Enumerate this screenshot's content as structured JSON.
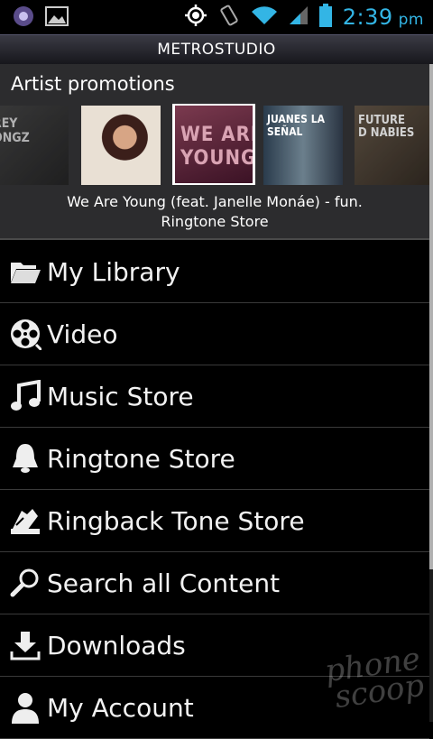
{
  "status_bar": {
    "time": "2:39",
    "ampm": "pm",
    "icons": [
      "app-icon",
      "gallery-icon",
      "gps-icon",
      "vibrate-icon",
      "wifi-icon",
      "signal-icon",
      "battery-icon"
    ],
    "accent_color": "#33b5e5"
  },
  "app": {
    "title": "METROSTUDIO"
  },
  "promotions": {
    "heading": "Artist promotions",
    "covers": [
      {
        "text": "REY\nONGZ"
      },
      {
        "text": ""
      },
      {
        "text": "WE ARE\nYOUNG"
      },
      {
        "text": "JUANES LA SEÑAL"
      },
      {
        "text": "FUTURE\nD NABIES"
      }
    ],
    "caption_line1": "We Are Young (feat. Janelle Monáe) - fun.",
    "caption_line2": "Ringtone Store"
  },
  "menu": {
    "items": [
      {
        "label": "My Library",
        "icon": "folder-icon"
      },
      {
        "label": "Video",
        "icon": "film-reel-icon"
      },
      {
        "label": "Music Store",
        "icon": "music-note-icon"
      },
      {
        "label": "Ringtone Store",
        "icon": "bell-icon"
      },
      {
        "label": "Ringback Tone Store",
        "icon": "ringback-phone-icon"
      },
      {
        "label": "Search all Content",
        "icon": "search-icon"
      },
      {
        "label": "Downloads",
        "icon": "download-icon"
      },
      {
        "label": "My Account",
        "icon": "person-icon"
      }
    ]
  },
  "watermark": {
    "line1": "phone",
    "line2": "scoop"
  }
}
